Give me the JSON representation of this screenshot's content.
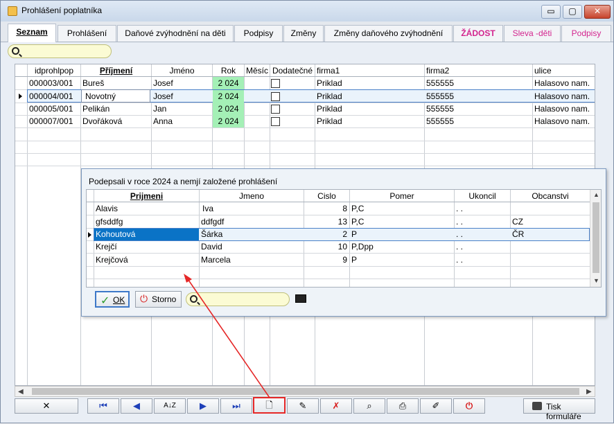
{
  "window": {
    "title": "Prohlášení poplatníka",
    "minimize_label": "▭",
    "maximize_label": "▢",
    "close_label": "✕"
  },
  "tabs": [
    {
      "label": "Seznam"
    },
    {
      "label": "Prohlášení"
    },
    {
      "label": "Daňové zvýhodnění na děti"
    },
    {
      "label": "Podpisy"
    },
    {
      "label": "Změny"
    },
    {
      "label": "Změny daňového zvýhodnění"
    },
    {
      "label": "ŽÁDOST"
    },
    {
      "label": "Sleva -děti"
    },
    {
      "label": "Podpisy"
    }
  ],
  "search": {
    "value": ""
  },
  "grid": {
    "columns": [
      "idprohlpop",
      "Příjmení",
      "Jméno",
      "Rok",
      "Měsíc",
      "Dodatečné",
      "firma1",
      "firma2",
      "ulice"
    ],
    "rows": [
      {
        "id": "000003/001",
        "prijmeni": "Bureš",
        "jmeno": "Josef",
        "rok": "2 024",
        "mesic": "",
        "firma1": "Priklad",
        "firma2": "555555",
        "ulice": "Halasovo nam."
      },
      {
        "id": "000004/001",
        "prijmeni": "Novotný",
        "jmeno": "Josef",
        "rok": "2 024",
        "mesic": "",
        "firma1": "Priklad",
        "firma2": "555555",
        "ulice": "Halasovo nam."
      },
      {
        "id": "000005/001",
        "prijmeni": "Pelikán",
        "jmeno": "Jan",
        "rok": "2 024",
        "mesic": "",
        "firma1": "Priklad",
        "firma2": "555555",
        "ulice": "Halasovo nam."
      },
      {
        "id": "000007/001",
        "prijmeni": "Dvořáková",
        "jmeno": "Anna",
        "rok": "2 024",
        "mesic": "",
        "firma1": "Priklad",
        "firma2": "555555",
        "ulice": "Halasovo nam."
      }
    ]
  },
  "dialog": {
    "title": "Podepsali v roce 2024 a nemjí založené prohlášení",
    "columns": [
      "Prijmeni",
      "Jmeno",
      "Cislo",
      "Pomer",
      "Ukoncil",
      "Obcanstvi"
    ],
    "rows": [
      {
        "prijmeni": "Alavis",
        "jmeno": "Iva",
        "cislo": "8",
        "pomer": "P,C",
        "ukoncil": ". .",
        "obcanstvi": ""
      },
      {
        "prijmeni": "gfsddfg",
        "jmeno": "ddfgdf",
        "cislo": "13",
        "pomer": "P,C",
        "ukoncil": ". .",
        "obcanstvi": "CZ"
      },
      {
        "prijmeni": "Kohoutová",
        "jmeno": "Šárka",
        "cislo": "2",
        "pomer": "P",
        "ukoncil": ". .",
        "obcanstvi": "ČR"
      },
      {
        "prijmeni": "Krejčí",
        "jmeno": "David",
        "cislo": "10",
        "pomer": "P,Dpp",
        "ukoncil": ". .",
        "obcanstvi": ""
      },
      {
        "prijmeni": "Krejčová",
        "jmeno": "Marcela",
        "cislo": "9",
        "pomer": "P",
        "ukoncil": ". .",
        "obcanstvi": ""
      }
    ],
    "ok_label": "OK",
    "storno_label": "Storno",
    "search_value": ""
  },
  "toolbar": {
    "close_label": "✕",
    "first_label": "⏮",
    "prev_label": "◀",
    "sort_label": "A↓Z",
    "next_label": "▶",
    "last_label": "⏭",
    "new_label": "🗋",
    "edit_label": "✎",
    "delete_label": "✗",
    "find_label": "⌕",
    "print_label": "⎙",
    "tools_label": "✐",
    "power_label": "⏻",
    "print_form_label": "Tisk formuláře"
  },
  "annotation": {
    "color": "#e52727"
  }
}
